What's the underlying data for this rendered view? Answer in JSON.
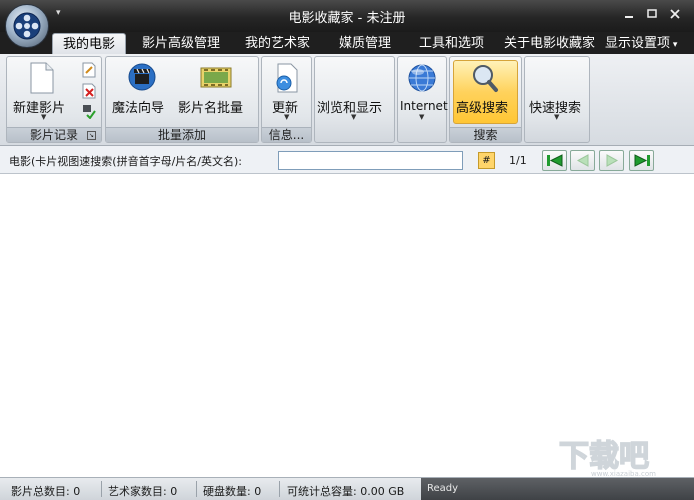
{
  "window": {
    "title": "电影收藏家 - 未注册",
    "qat_arrow": "▾"
  },
  "tabs": [
    {
      "label": "我的电影",
      "active": true
    },
    {
      "label": "影片高级管理",
      "active": false
    },
    {
      "label": "我的艺术家",
      "active": false
    },
    {
      "label": "媒质管理",
      "active": false
    },
    {
      "label": "工具和选项",
      "active": false
    },
    {
      "label": "关于电影收藏家",
      "active": false
    }
  ],
  "display_settings": "显示设置项",
  "ribbon": {
    "groups": [
      {
        "caption": "影片记录",
        "buttons": [
          {
            "label": "新建影片"
          }
        ]
      },
      {
        "caption": "批量添加",
        "buttons": [
          {
            "label": "魔法向导"
          },
          {
            "label": "影片名批量"
          }
        ]
      },
      {
        "caption": "信息...",
        "buttons": [
          {
            "label": "更新"
          }
        ]
      },
      {
        "caption": "",
        "buttons": [
          {
            "label": "浏览和显示"
          }
        ]
      },
      {
        "caption": "",
        "buttons": [
          {
            "label": "Internet"
          }
        ]
      },
      {
        "caption": "搜索",
        "buttons": [
          {
            "label": "高级搜索"
          }
        ]
      },
      {
        "caption": "",
        "buttons": [
          {
            "label": "快速搜索"
          }
        ]
      }
    ]
  },
  "search": {
    "label": "电影(卡片视图速搜索(拼音首字母/片名/英文名):",
    "value": "",
    "hash_label": "#",
    "page": "1/1"
  },
  "status": {
    "film_count": "影片总数目: 0",
    "artist_count": "艺术家数目: 0",
    "disk_count": "硬盘数量: 0",
    "capacity": "可统计总容量: 0.00 GB",
    "ready": "Ready"
  },
  "watermark": {
    "text": "下载吧",
    "url": "www.xiazaiba.com"
  },
  "colors": {
    "titlebar": "#262626",
    "highlight": "#ffd25c",
    "nav_green": "#1f9b2e"
  }
}
